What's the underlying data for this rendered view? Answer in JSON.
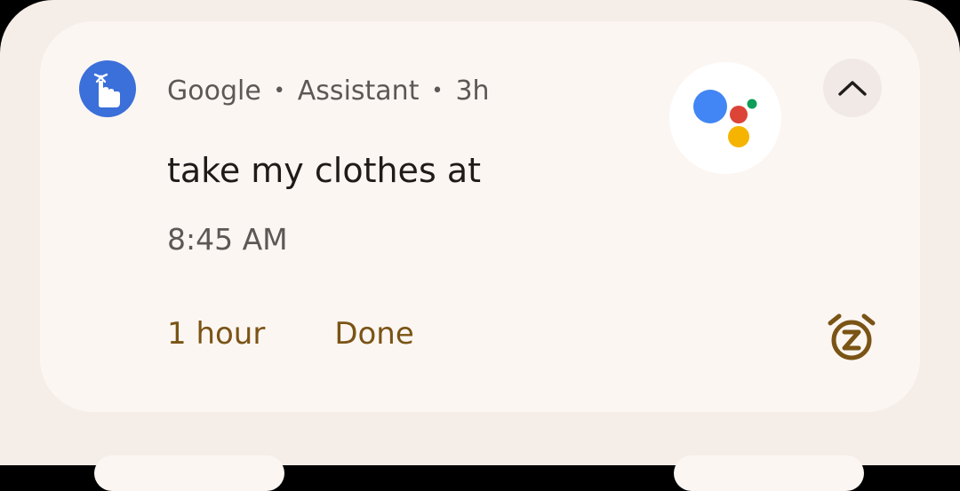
{
  "notification": {
    "app_name": "Google",
    "channel": "Assistant",
    "age": "3h",
    "title": "take my clothes at",
    "time": "8:45 AM",
    "actions": [
      "1 hour",
      "Done"
    ],
    "app_icon": "finger-ribbon-reminder-icon",
    "large_icon": "google-assistant-logo",
    "expand_icon": "chevron-up-icon",
    "snooze_icon": "snooze-alarm-icon"
  },
  "colors": {
    "app_icon_bg": "#3b6fd9",
    "action_text": "#7a5415",
    "card_bg": "#fcf6f3",
    "shade_bg": "#f5ede8"
  }
}
